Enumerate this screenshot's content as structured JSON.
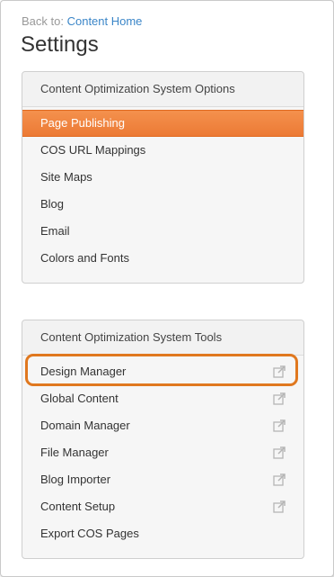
{
  "back": {
    "prefix": "Back to:",
    "link": "Content Home"
  },
  "title": "Settings",
  "options_panel": {
    "header": "Content Optimization System Options",
    "items": [
      {
        "label": "Page Publishing",
        "active": true
      },
      {
        "label": "COS URL Mappings"
      },
      {
        "label": "Site Maps"
      },
      {
        "label": "Blog"
      },
      {
        "label": "Email"
      },
      {
        "label": "Colors and Fonts"
      }
    ]
  },
  "tools_panel": {
    "header": "Content Optimization System Tools",
    "items": [
      {
        "label": "Design Manager",
        "icon": "external-link-icon",
        "highlighted": true
      },
      {
        "label": "Global Content",
        "icon": "external-link-icon"
      },
      {
        "label": "Domain Manager",
        "icon": "external-link-icon"
      },
      {
        "label": "File Manager",
        "icon": "external-link-icon"
      },
      {
        "label": "Blog Importer",
        "icon": "external-link-icon"
      },
      {
        "label": "Content Setup",
        "icon": "external-link-icon"
      },
      {
        "label": "Export COS Pages"
      }
    ]
  },
  "colors": {
    "accent": "#ec7a35",
    "link": "#3b86c8",
    "highlight_border": "#e0781f"
  }
}
